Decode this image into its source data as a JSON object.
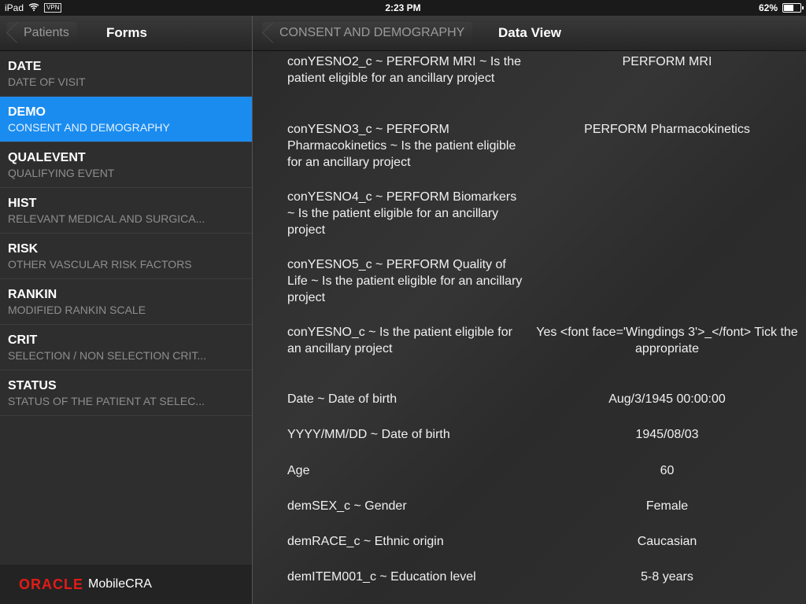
{
  "status": {
    "device": "iPad",
    "vpn": "VPN",
    "time": "2:23 PM",
    "battery_percent": "62%",
    "battery_level": 0.62
  },
  "left": {
    "back_label": "Patients",
    "title": "Forms",
    "items": [
      {
        "code": "DATE",
        "desc": "DATE OF VISIT"
      },
      {
        "code": "DEMO",
        "desc": "CONSENT AND DEMOGRAPHY"
      },
      {
        "code": "QUALEVENT",
        "desc": "QUALIFYING EVENT"
      },
      {
        "code": "HIST",
        "desc": "RELEVANT MEDICAL AND SURGICA..."
      },
      {
        "code": "RISK",
        "desc": "OTHER VASCULAR RISK FACTORS"
      },
      {
        "code": "RANKIN",
        "desc": "MODIFIED RANKIN SCALE"
      },
      {
        "code": "CRIT",
        "desc": "SELECTION / NON SELECTION CRIT..."
      },
      {
        "code": "STATUS",
        "desc": "STATUS OF THE PATIENT AT SELEC..."
      }
    ],
    "footer": {
      "brand": "ORACLE",
      "app": "MobileCRA"
    }
  },
  "right": {
    "back_label": "CONSENT AND DEMOGRAPHY",
    "title": "Data View",
    "rows": [
      {
        "label": "conYESNO2_c ~ PERFORM MRI ~ Is the patient eligible for an ancillary project",
        "value": "PERFORM MRI"
      },
      {
        "label": "conYESNO3_c ~ PERFORM Pharmacokinetics ~ Is the patient eligible for an ancillary project",
        "value": "PERFORM Pharmacokinetics"
      },
      {
        "label": "conYESNO4_c ~ PERFORM Biomarkers ~ Is the patient eligible for an ancillary project",
        "value": ""
      },
      {
        "label": "conYESNO5_c ~ PERFORM Quality of Life ~ Is the patient eligible for an ancillary project",
        "value": ""
      },
      {
        "label": "conYESNO_c ~ Is the patient eligible for an ancillary project",
        "value": "Yes <font face='Wingdings 3'>_</font> Tick the appropriate"
      },
      {
        "label": "Date ~ Date of birth",
        "value": "Aug/3/1945 00:00:00"
      },
      {
        "label": "YYYY/MM/DD ~ Date of birth",
        "value": "1945/08/03"
      },
      {
        "label": "Age",
        "value": "60"
      },
      {
        "label": "demSEX_c ~ Gender",
        "value": "Female"
      },
      {
        "label": "demRACE_c ~ Ethnic origin",
        "value": "Caucasian"
      },
      {
        "label": "demITEM001_c ~ Education level",
        "value": "5-8 years"
      }
    ]
  }
}
